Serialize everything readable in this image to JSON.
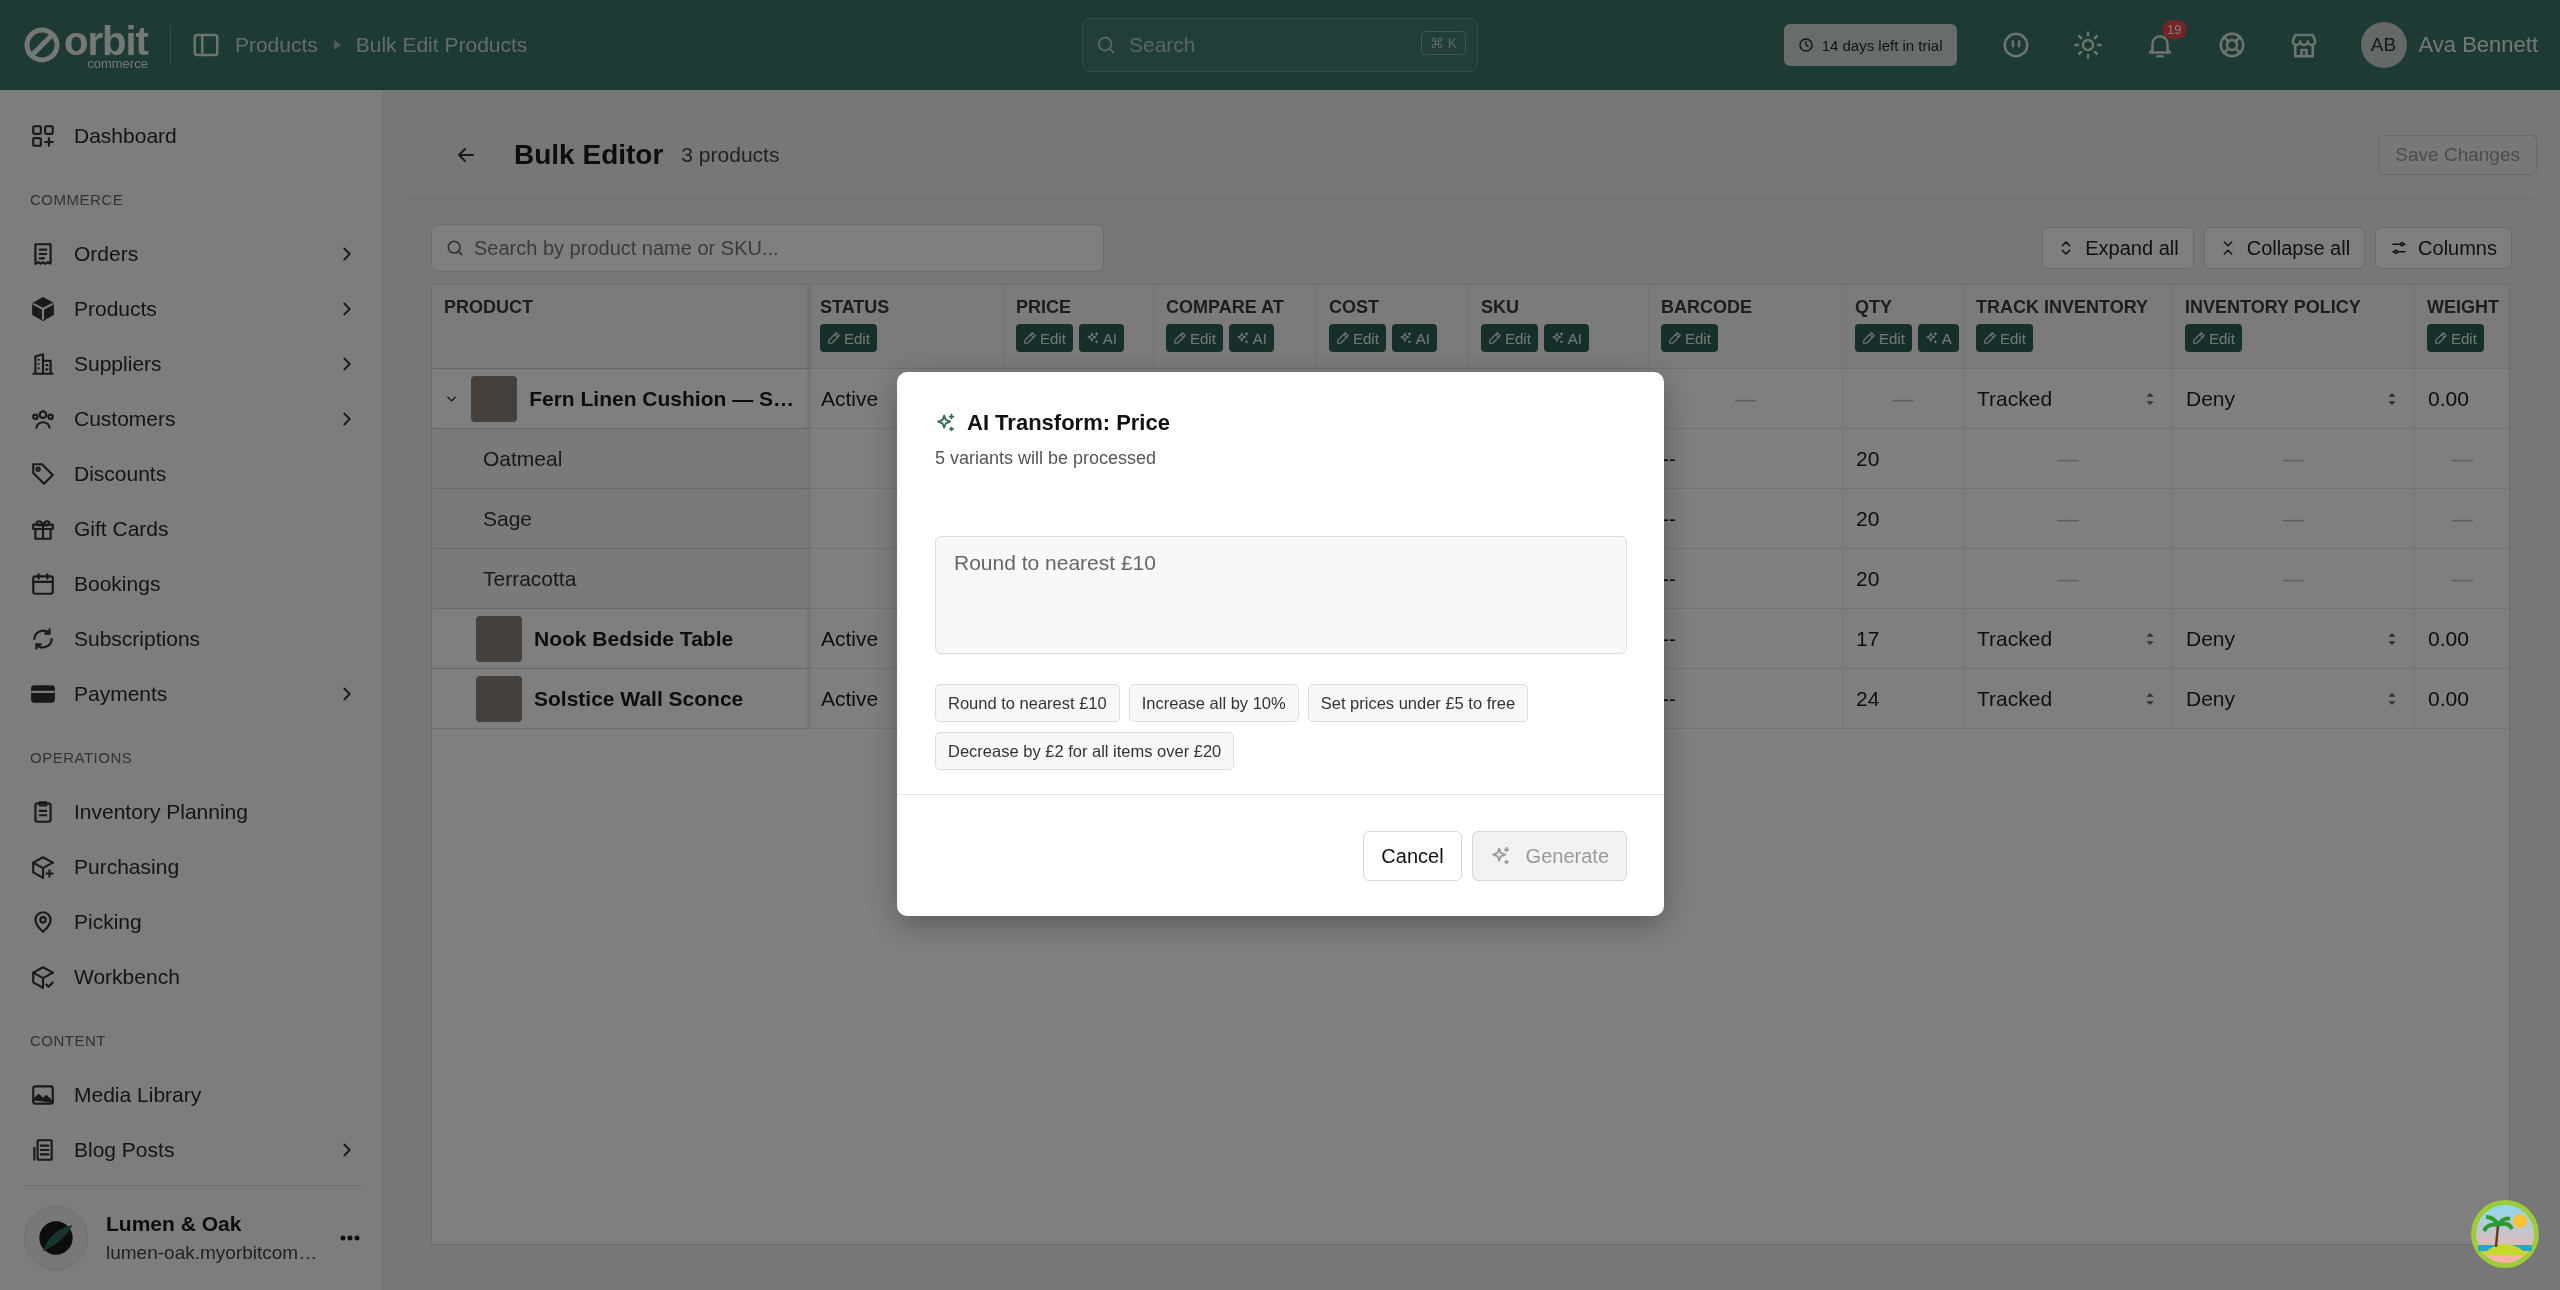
{
  "topbar": {
    "logo": "orbit",
    "logo_sub": "commerce",
    "breadcrumbs": [
      "Products",
      "Bulk Edit Products"
    ],
    "search": {
      "placeholder": "Search",
      "shortcut": "⌘ K"
    },
    "trial_badge": "14 days left in trial",
    "notification_count": "19",
    "user": {
      "initials": "AB",
      "name": "Ava Bennett"
    }
  },
  "sidebar": {
    "items": [
      {
        "label": "Dashboard",
        "has_submenu": false
      }
    ],
    "sections": [
      {
        "title": "COMMERCE",
        "items": [
          {
            "label": "Orders",
            "has_submenu": true
          },
          {
            "label": "Products",
            "has_submenu": true
          },
          {
            "label": "Suppliers",
            "has_submenu": true
          },
          {
            "label": "Customers",
            "has_submenu": true
          },
          {
            "label": "Discounts",
            "has_submenu": false
          },
          {
            "label": "Gift Cards",
            "has_submenu": false
          },
          {
            "label": "Bookings",
            "has_submenu": false
          },
          {
            "label": "Subscriptions",
            "has_submenu": false
          },
          {
            "label": "Payments",
            "has_submenu": true
          }
        ]
      },
      {
        "title": "OPERATIONS",
        "items": [
          {
            "label": "Inventory Planning",
            "has_submenu": false
          },
          {
            "label": "Purchasing",
            "has_submenu": false
          },
          {
            "label": "Picking",
            "has_submenu": false
          },
          {
            "label": "Workbench",
            "has_submenu": false
          }
        ]
      },
      {
        "title": "CONTENT",
        "items": [
          {
            "label": "Media Library",
            "has_submenu": false
          },
          {
            "label": "Blog Posts",
            "has_submenu": true
          }
        ]
      }
    ],
    "store": {
      "name": "Lumen & Oak",
      "domain": "lumen-oak.myorbitcom…"
    }
  },
  "page": {
    "title": "Bulk Editor",
    "count": "3 products",
    "save_button": {
      "label": "Save Changes",
      "disabled": true
    },
    "search": {
      "placeholder": "Search by product name or SKU..."
    },
    "toolbar": [
      "Expand all",
      "Collapse all",
      "Columns"
    ]
  },
  "table": {
    "columns": [
      {
        "label": "PRODUCT"
      },
      {
        "label": "STATUS",
        "actions": [
          {
            "kind": "edit",
            "label": "Edit"
          }
        ]
      },
      {
        "label": "PRICE",
        "actions": [
          {
            "kind": "edit",
            "label": "Edit"
          },
          {
            "kind": "ai",
            "label": "AI"
          }
        ]
      },
      {
        "label": "COMPARE AT",
        "actions": [
          {
            "kind": "edit",
            "label": "Edit"
          },
          {
            "kind": "ai",
            "label": "AI"
          }
        ]
      },
      {
        "label": "COST",
        "actions": [
          {
            "kind": "edit",
            "label": "Edit"
          },
          {
            "kind": "ai",
            "label": "AI"
          }
        ]
      },
      {
        "label": "SKU",
        "actions": [
          {
            "kind": "edit",
            "label": "Edit"
          },
          {
            "kind": "ai",
            "label": "AI"
          }
        ]
      },
      {
        "label": "BARCODE",
        "actions": [
          {
            "kind": "edit",
            "label": "Edit"
          }
        ]
      },
      {
        "label": "QTY",
        "actions": [
          {
            "kind": "edit",
            "label": "Edit"
          },
          {
            "kind": "ai",
            "label": "A"
          }
        ]
      },
      {
        "label": "TRACK INVENTORY",
        "actions": [
          {
            "kind": "edit",
            "label": "Edit"
          }
        ]
      },
      {
        "label": "INVENTORY POLICY",
        "actions": [
          {
            "kind": "edit",
            "label": "Edit"
          }
        ]
      },
      {
        "label": "WEIGHT",
        "actions": [
          {
            "kind": "edit",
            "label": "Edit"
          }
        ]
      }
    ],
    "rows": [
      {
        "name": "Fern Linen Cushion — S…",
        "status": "Active",
        "barcode": "—",
        "qty": "—",
        "track_inventory": "Tracked",
        "inventory_policy": "Deny",
        "weight": "0.00",
        "expanded": true,
        "children": [
          {
            "name": "Oatmeal",
            "barcode": "--",
            "qty": "20",
            "track_inventory": "—",
            "inventory_policy": "—",
            "weight": "—"
          },
          {
            "name": "Sage",
            "barcode": "--",
            "qty": "20",
            "track_inventory": "—",
            "inventory_policy": "—",
            "weight": "—"
          },
          {
            "name": "Terracotta",
            "barcode": "--",
            "qty": "20",
            "track_inventory": "—",
            "inventory_policy": "—",
            "weight": "—"
          }
        ]
      },
      {
        "name": "Nook Bedside Table",
        "status": "Active",
        "barcode": "--",
        "qty": "17",
        "track_inventory": "Tracked",
        "inventory_policy": "Deny",
        "weight": "0.00"
      },
      {
        "name": "Solstice Wall Sconce",
        "status": "Active",
        "barcode": "--",
        "qty": "24",
        "track_inventory": "Tracked",
        "inventory_policy": "Deny",
        "weight": "0.00"
      }
    ]
  },
  "modal": {
    "title": "AI Transform: Price",
    "subtitle": "5 variants will be processed",
    "prompt": {
      "placeholder": "Round to nearest £10"
    },
    "suggestions": [
      "Round to nearest £10",
      "Increase all by 10%",
      "Set prices under £5 to free",
      "Decrease by £2 for all items over £20"
    ],
    "cancel_button": {
      "label": "Cancel"
    },
    "generate_button": {
      "label": "Generate",
      "disabled": true
    }
  }
}
